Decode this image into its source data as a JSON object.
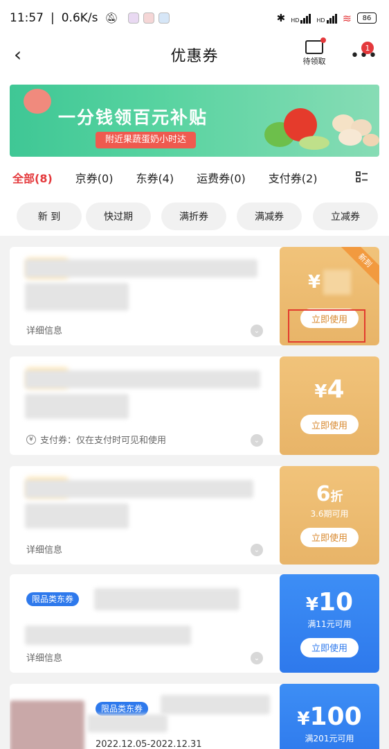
{
  "status_bar": {
    "time": "11:57",
    "speed": "0.6K/s",
    "battery": "86",
    "net1": "HD",
    "net2": "HD"
  },
  "header": {
    "title": "优惠券",
    "back_icon": "‹",
    "pending_label": "待领取",
    "more_badge": "1"
  },
  "banner": {
    "title": "一分钱领百元补贴",
    "subtitle": "附近果蔬蛋奶小时达"
  },
  "tabs": [
    {
      "label": "全部(8)",
      "active": true
    },
    {
      "label": "京券(0)"
    },
    {
      "label": "东券(4)"
    },
    {
      "label": "运费券(0)"
    },
    {
      "label": "支付券(2)"
    }
  ],
  "filters": [
    "新 到",
    "快过期",
    "满折券",
    "满减券",
    "立减券"
  ],
  "coupons": [
    {
      "detail": "详细信息",
      "amount_currency": "¥",
      "amount_value": "",
      "button": "立即使用",
      "ribbon": "新到"
    },
    {
      "detail_icon": "¥",
      "detail": "支付券：仅在支付时可见和使用",
      "amount_currency": "¥",
      "amount_value": "4",
      "button": "立即使用"
    },
    {
      "detail": "详细信息",
      "amount_value": "6",
      "amount_unit": "折",
      "condition": "3.6期可用",
      "button": "立即使用"
    },
    {
      "tag": "限品类东券",
      "detail": "详细信息",
      "amount_currency": "¥",
      "amount_value": "10",
      "condition": "满11元可用",
      "button": "立即使用"
    },
    {
      "tag": "限品类东券",
      "date": "2022.12.05-2022.12.31",
      "amount_currency": "¥",
      "amount_value": "100",
      "condition": "满201元可用"
    }
  ],
  "colors": {
    "accent_red": "#e4393c",
    "coupon_orange": "#e8b468",
    "coupon_blue": "#2e79ec"
  }
}
